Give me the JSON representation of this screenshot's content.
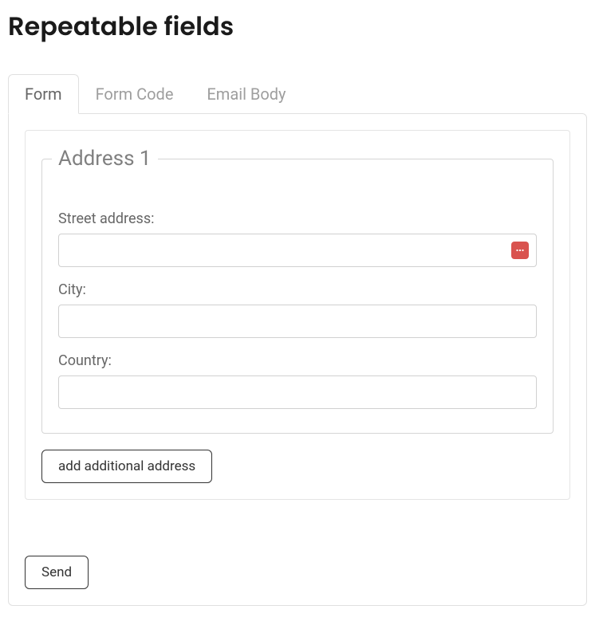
{
  "page": {
    "title": "Repeatable fields"
  },
  "tabs": [
    {
      "label": "Form",
      "active": true
    },
    {
      "label": "Form Code",
      "active": false
    },
    {
      "label": "Email Body",
      "active": false
    }
  ],
  "form": {
    "fieldset": {
      "legend": "Address 1",
      "fields": {
        "street": {
          "label": "Street address:",
          "value": ""
        },
        "city": {
          "label": "City:",
          "value": ""
        },
        "country": {
          "label": "Country:",
          "value": ""
        }
      }
    },
    "buttons": {
      "add": "add additional address",
      "send": "Send"
    }
  }
}
